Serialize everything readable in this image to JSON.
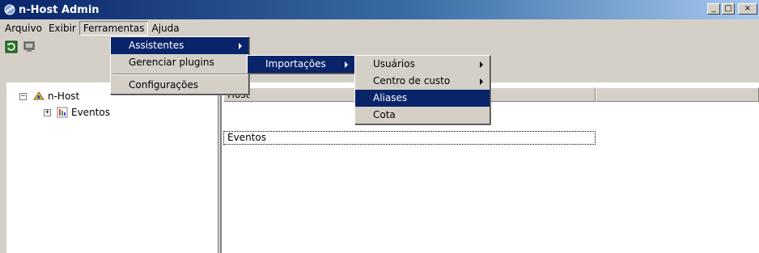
{
  "window": {
    "title": "n-Host Admin",
    "controls": {
      "minimize": "_",
      "maximize": "□",
      "close": "×"
    }
  },
  "menubar": {
    "items": [
      {
        "label": "Arquivo"
      },
      {
        "label": "Exibir"
      },
      {
        "label": "Ferramentas",
        "open": true
      },
      {
        "label": "Ajuda"
      }
    ]
  },
  "toolbar": {
    "buttons": [
      {
        "icon": "refresh-icon"
      },
      {
        "icon": "computer-icon"
      }
    ]
  },
  "tree": {
    "root": {
      "label": "n-Host",
      "expander": "−",
      "icon": "n-host-icon"
    },
    "child": {
      "label": "Eventos",
      "expander": "+",
      "icon": "event-icon"
    }
  },
  "list": {
    "columns": [
      {
        "label": "Host"
      },
      {
        "label": ""
      }
    ],
    "rows": [
      {
        "label": "Eventos"
      }
    ]
  },
  "menus": {
    "ferramentas": {
      "items": [
        {
          "label": "Assistentes",
          "submenu": true,
          "highlighted": true
        },
        {
          "label": "Gerenciar plugins"
        },
        {
          "separator": true
        },
        {
          "label": "Configurações"
        }
      ]
    },
    "assistentes": {
      "items": [
        {
          "label": "Importações",
          "submenu": true,
          "highlighted": true
        }
      ]
    },
    "importacoes": {
      "items": [
        {
          "label": "Usuários",
          "submenu": true
        },
        {
          "label": "Centro de custo",
          "submenu": true
        },
        {
          "label": "Aliases",
          "highlighted": true
        },
        {
          "label": "Cota"
        }
      ]
    }
  },
  "colors": {
    "title_gradient_start": "#0a246a",
    "title_gradient_end": "#a6caf0",
    "menu_highlight": "#0a246a",
    "chrome": "#d4d0c8"
  }
}
